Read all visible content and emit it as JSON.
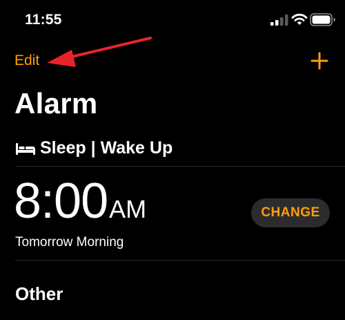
{
  "status_bar": {
    "time": "11:55",
    "icons": [
      "signal-icon",
      "wifi-icon",
      "battery-icon"
    ]
  },
  "nav": {
    "edit_label": "Edit",
    "add_icon": "plus-icon"
  },
  "page_title": "Alarm",
  "sleep_section": {
    "icon": "bed-icon",
    "label": "Sleep | Wake Up",
    "alarm": {
      "time": "8:00",
      "period": "AM",
      "subtitle": "Tomorrow Morning",
      "change_label": "CHANGE"
    }
  },
  "other_section": {
    "label": "Other"
  },
  "colors": {
    "accent": "#ff9f0a",
    "background": "#000000",
    "annotation_arrow": "#e8242b",
    "button_bg": "#2c2c2e"
  }
}
